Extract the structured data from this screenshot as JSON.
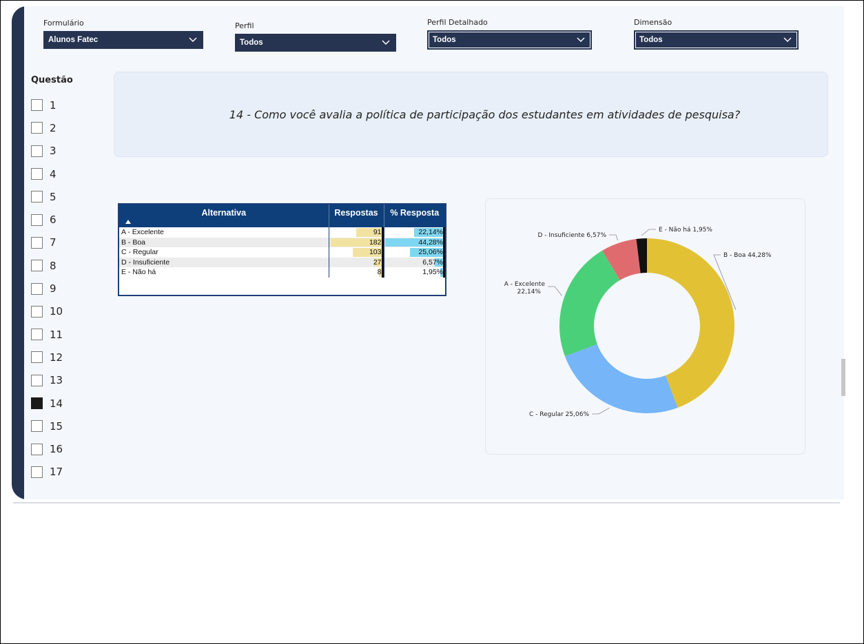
{
  "filters": [
    {
      "label": "Formulário",
      "value": "Alunos Fatec"
    },
    {
      "label": "Perfil",
      "value": "Todos"
    },
    {
      "label": "Perfil Detalhado",
      "value": "Todos"
    },
    {
      "label": "Dimensão",
      "value": "Todos"
    }
  ],
  "questao": {
    "title": "Questão",
    "items": [
      "1",
      "2",
      "3",
      "4",
      "5",
      "6",
      "7",
      "8",
      "9",
      "10",
      "11",
      "12",
      "13",
      "14",
      "15",
      "16",
      "17"
    ],
    "selected": "14"
  },
  "question_text": "14 - Como você avalia a política de participação dos estudantes em atividades de pesquisa?",
  "table": {
    "headers": [
      "Alternativa",
      "Respostas",
      "% Resposta"
    ],
    "rows": [
      {
        "alt": "A - Excelente",
        "resp": "91",
        "pct": "22,14%"
      },
      {
        "alt": "B - Boa",
        "resp": "182",
        "pct": "44,28%"
      },
      {
        "alt": "C - Regular",
        "resp": "103",
        "pct": "25,06%"
      },
      {
        "alt": "D - Insuficiente",
        "resp": "27",
        "pct": "6,57%"
      },
      {
        "alt": "E - Não há",
        "resp": "8",
        "pct": "1,95%"
      }
    ],
    "bar_colors": {
      "resp": "#f1e2a0",
      "pct": "#7fd6f0"
    }
  },
  "chart_data": {
    "type": "pie",
    "donut": true,
    "categories": [
      "B - Boa",
      "C - Regular",
      "A - Excelente",
      "D - Insuficiente",
      "E - Não há"
    ],
    "values": [
      44.28,
      25.06,
      22.14,
      6.57,
      1.95
    ],
    "colors": [
      "#e2c234",
      "#75b5f8",
      "#4bd07a",
      "#e06b6e",
      "#111111"
    ],
    "labels": [
      "B - Boa 44,28%",
      "C - Regular 25,06%",
      "A - Excelente 22,14%",
      "D - Insuficiente 6,57%",
      "E - Não há 1,95%"
    ]
  }
}
